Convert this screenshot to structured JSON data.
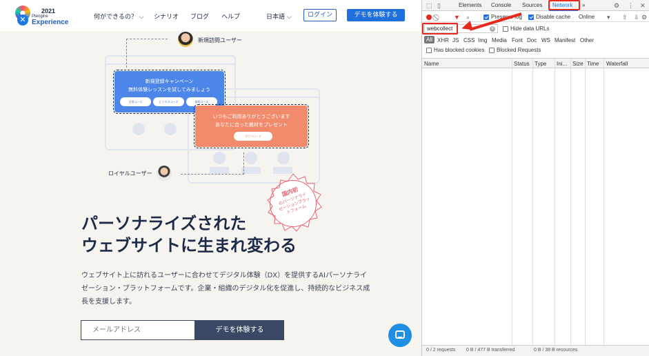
{
  "site": {
    "logo": {
      "year": "2021",
      "brand_small": "Ptengine",
      "brand_big": "Experience"
    },
    "nav": {
      "links": [
        "何ができるの？",
        "シナリオ",
        "ブログ",
        "ヘルプ"
      ],
      "language": "日本語",
      "login": "ログイン",
      "demo": "デモを体験する"
    },
    "illustration": {
      "new_user_label": "新規訪問ユーザー",
      "loyal_user_label": "ロイヤルユーザー",
      "blue_card": {
        "line1": "新規登録キャンペーン",
        "line2": "無料体験レッスンを試してみましょう",
        "pills": [
          "日常コース",
          "ビジネスコース",
          "資格コース"
        ]
      },
      "orange_card": {
        "line1": "いつもご利用ありがとうございます",
        "line2": "あなたに合った教材をプレゼント",
        "button": "ダウンロード"
      },
      "seal": {
        "line1": "国内初",
        "line2": "のパーソナライ",
        "line3": "ゼーションプラッ",
        "line4": "トフォーム"
      }
    },
    "headline": {
      "line1": "パーソナライズされた",
      "line2": "ウェブサイトに生まれ変わる"
    },
    "description": "ウェブサイト上に訪れるユーザーに合わせてデジタル体験（DX）を提供するAIパーソナライゼーション・プラットフォームです。企業・組織のデジタル化を促進し、持続的なビジネス成長を支援します。",
    "email_placeholder": "メールアドレス",
    "demo_button": "デモを体験する"
  },
  "devtools": {
    "tabs": [
      "Elements",
      "Console",
      "Sources",
      "Network",
      "»"
    ],
    "active_tab": "Network",
    "toolbar": {
      "preserve_log": "Preserve log",
      "disable_cache": "Disable cache",
      "throttle": "Online"
    },
    "filter": {
      "value": "webcollect",
      "hide_data_urls": "Hide data URLs"
    },
    "types": [
      "All",
      "XHR",
      "JS",
      "CSS",
      "Img",
      "Media",
      "Font",
      "Doc",
      "WS",
      "Manifest",
      "Other"
    ],
    "has_blocked_cookies": "Has blocked cookies",
    "blocked_requests": "Blocked Requests",
    "columns": [
      "Name",
      "Status",
      "Type",
      "Ini...",
      "Size",
      "Time",
      "Waterfall"
    ],
    "status": {
      "requests": "0 / 2 requests",
      "transferred": "0 B / 477 B transferred",
      "resources": "0 B / 38 B resources"
    },
    "highlight_color": "#e8281a",
    "accent_color": "#1a73e8"
  }
}
